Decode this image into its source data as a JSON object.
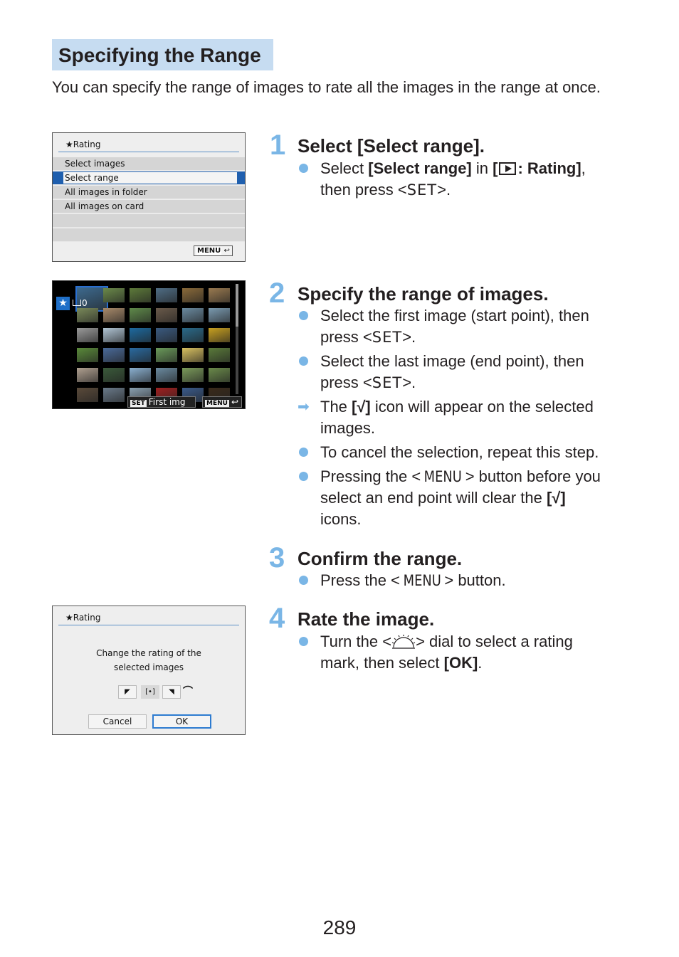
{
  "section": {
    "title": "Specifying the Range",
    "intro": "You can specify the range of images to rate all the images in the range at once."
  },
  "screen1": {
    "title": "★Rating",
    "items": [
      "Select images",
      "Select range",
      "All images in folder",
      "All images on card"
    ],
    "selected_index": 1,
    "menu_label": "MENU",
    "back_icon": "↩"
  },
  "screen2": {
    "star_icon": "★",
    "count": "0",
    "set_label": "SET",
    "hint": "First img",
    "menu_label": "MENU",
    "back_icon": "↩",
    "thumbnail_rows": 6,
    "thumbnail_cols": 6,
    "thumb_colors": [
      [
        "#3d6a8f",
        "#6b8a4a",
        "#5d7a3a",
        "#4f6d85",
        "#8a6a3a",
        "#9a7a50"
      ],
      [
        "#7a8a5a",
        "#a88a6a",
        "#5f8a4a",
        "#6a5a4a",
        "#6a8aa0",
        "#7a9ab0"
      ],
      [
        "#9a9a9a",
        "#b0c4d4",
        "#1d6aa0",
        "#3a5a80",
        "#2a6a8a",
        "#c8a020"
      ],
      [
        "#5a8a3a",
        "#4a6a9a",
        "#2a6aa0",
        "#6a9a5a",
        "#d8c060",
        "#5a7a3a"
      ],
      [
        "#b0a090",
        "#3a5a3a",
        "#8ab0d0",
        "#6a8aa0",
        "#7a9a5a",
        "#6a8a4a"
      ],
      [
        "#5a4a3a",
        "#6a7a8a",
        "#8aa0b0",
        "#a02020",
        "#3a5a8a",
        "#3a2a1a"
      ]
    ]
  },
  "screen3": {
    "title": "★Rating",
    "message_line1": "Change the rating of the",
    "message_line2": "selected images",
    "dial_left": "◤",
    "dial_mid": "[•]",
    "dial_right": "◥",
    "dial_arrow": "⌒",
    "cancel_label": "Cancel",
    "ok_label": "OK"
  },
  "steps": [
    {
      "number": "1",
      "title": "Select [Select range].",
      "bullet1": {
        "pre": "Select ",
        "b1": "[Select range]",
        "mid": " in ",
        "b2a": "[",
        "b2b": ": Rating]",
        "post": ",",
        "line2_pre": "then press <",
        "key": "SET",
        "line2_post": ">."
      }
    },
    {
      "number": "2",
      "title": "Specify the range of images.",
      "b1_l1": "Select the first image (start point), then",
      "b1_l2_pre": "press <",
      "key": "SET",
      "b1_l2_post": ">.",
      "b2_l1": "Select the last image (end point), then",
      "b2_l2_pre": "press <",
      "b2_l2_post": ">.",
      "arrow_pre": "The ",
      "check": "[√]",
      "arrow_post": " icon will appear on the selected",
      "arrow_l2": "images.",
      "b3": "To cancel the selection, repeat this step.",
      "b4_l1_pre": "Pressing the <",
      "menu": "MENU",
      "b4_l1_post": "> button before you",
      "b4_l2_pre": "select an end point will clear the ",
      "b4_l3": "icons."
    },
    {
      "number": "3",
      "title": "Confirm the range.",
      "b1_pre": "Press the <",
      "menu": "MENU",
      "b1_post": "> button."
    },
    {
      "number": "4",
      "title": "Rate the image.",
      "b1_l1_pre": "Turn the <",
      "b1_l1_post": "> dial to select a rating",
      "b1_l2_pre": "mark, then select ",
      "ok": "[OK]",
      "b1_l2_post": "."
    }
  ],
  "page_number": "289"
}
